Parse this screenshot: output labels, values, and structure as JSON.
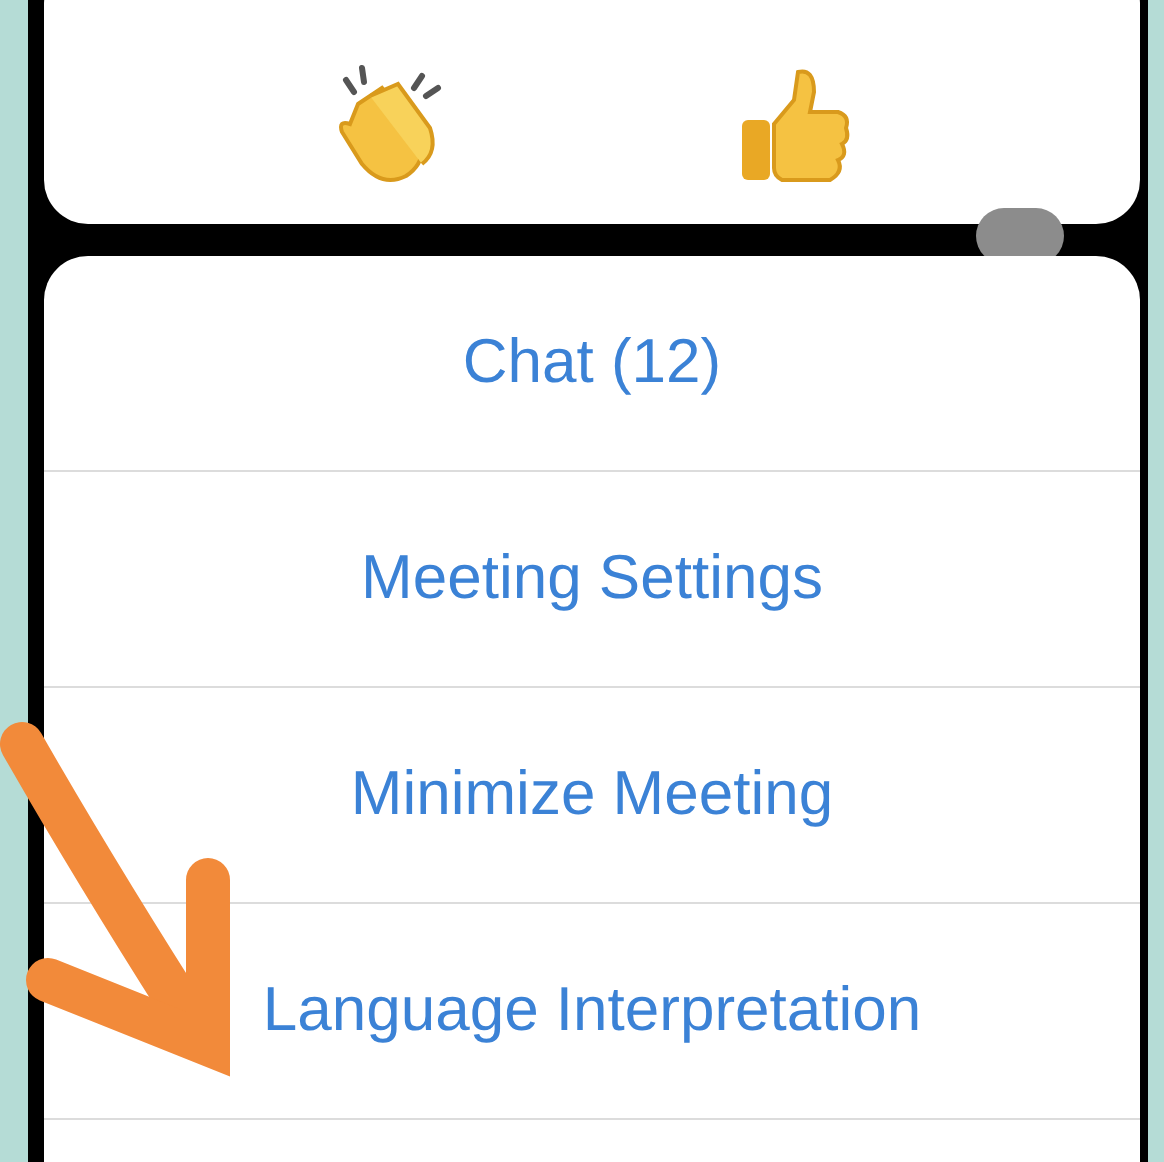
{
  "menu": {
    "items": [
      {
        "label": "Chat (12)"
      },
      {
        "label": "Meeting Settings"
      },
      {
        "label": "Minimize Meeting"
      },
      {
        "label": "Language Interpretation"
      }
    ]
  }
}
